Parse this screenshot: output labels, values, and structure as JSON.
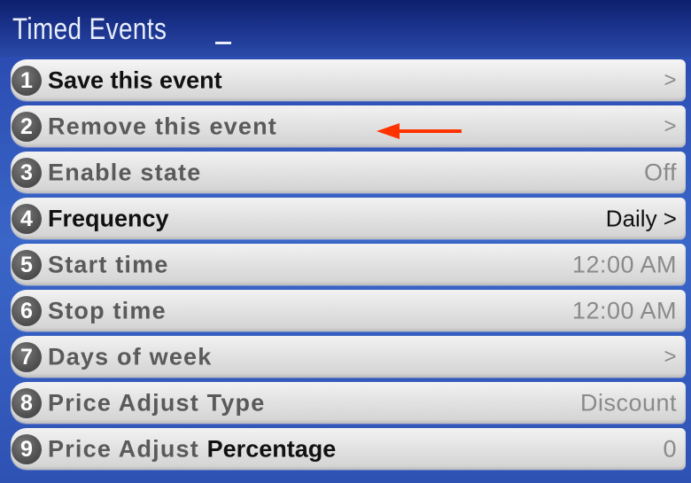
{
  "title": "Timed Events",
  "colors": {
    "background": "#2e52b4",
    "row": "#e3e3e3",
    "badge": "#555555",
    "annotation_arrow": "#ff3300"
  },
  "items": [
    {
      "number": "1",
      "label": "Save this event",
      "value": ">"
    },
    {
      "number": "2",
      "label": "Remove this event",
      "value": ">"
    },
    {
      "number": "3",
      "label": "Enable state",
      "value": "Off"
    },
    {
      "number": "4",
      "label": "Frequency",
      "value": "Daily >"
    },
    {
      "number": "5",
      "label": "Start time",
      "value": "12:00 AM"
    },
    {
      "number": "6",
      "label": "Stop time",
      "value": "12:00 AM"
    },
    {
      "number": "7",
      "label": "Days of week",
      "value": ">"
    },
    {
      "number": "8",
      "label": "Price Adjust Type",
      "value": "Discount"
    },
    {
      "number": "9",
      "label": "Price Adjust",
      "label_extra": "Percentage",
      "value": "0"
    }
  ]
}
